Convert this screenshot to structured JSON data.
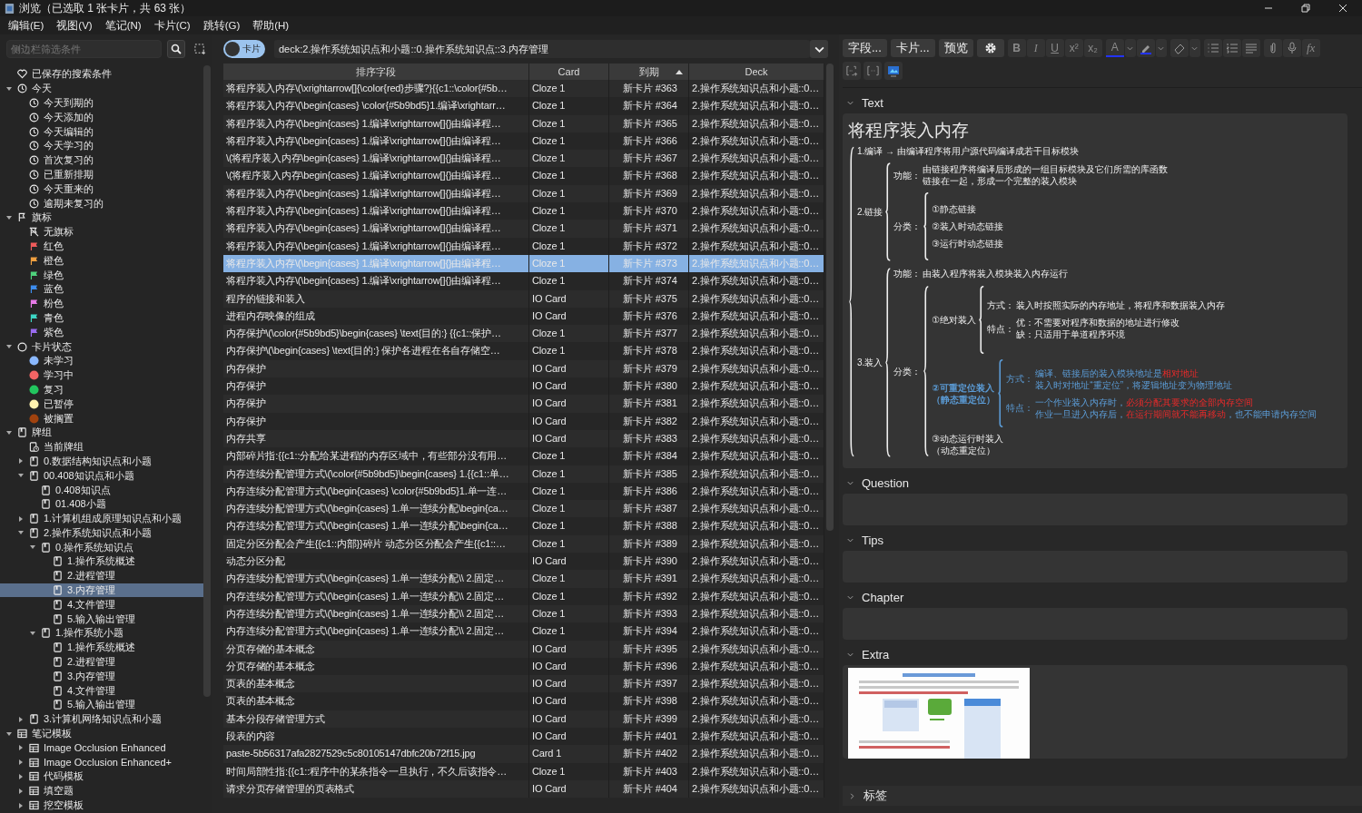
{
  "window": {
    "title": "浏览（已选取 1 张卡片，共 63 张）",
    "menu": [
      "编辑(E)",
      "视图(V)",
      "笔记(N)",
      "卡片(C)",
      "跳转(G)",
      "帮助(H)"
    ]
  },
  "sidebar": {
    "search_placeholder": "侧边栏筛选条件",
    "tree": [
      {
        "label": "已保存的搜索条件",
        "kind": "saved-search",
        "selected": false
      },
      {
        "label": "今天",
        "kind": "today",
        "selected": false,
        "expanded": true,
        "children": [
          {
            "label": "今天到期的",
            "kind": "time-filter",
            "selected": false
          },
          {
            "label": "今天添加的",
            "kind": "time-filter",
            "selected": false
          },
          {
            "label": "今天编辑的",
            "kind": "time-filter",
            "selected": false
          },
          {
            "label": "今天学习的",
            "kind": "time-filter",
            "selected": false
          },
          {
            "label": "首次复习的",
            "kind": "time-filter",
            "selected": false
          },
          {
            "label": "已重新排期",
            "kind": "time-filter",
            "selected": false
          },
          {
            "label": "今天重来的",
            "kind": "time-filter",
            "selected": false
          },
          {
            "label": "逾期未复习的",
            "kind": "time-filter",
            "selected": false
          }
        ]
      },
      {
        "label": "旗标",
        "kind": "flags",
        "selected": false,
        "expanded": true,
        "children": [
          {
            "label": "无旗标",
            "kind": "no-flag",
            "selected": false
          },
          {
            "label": "红色",
            "kind": "flag",
            "color": "#ef5b5b",
            "selected": false
          },
          {
            "label": "橙色",
            "kind": "flag",
            "color": "#f0a040",
            "selected": false
          },
          {
            "label": "绿色",
            "kind": "flag",
            "color": "#4fd27c",
            "selected": false
          },
          {
            "label": "蓝色",
            "kind": "flag",
            "color": "#3d8ef0",
            "selected": false
          },
          {
            "label": "粉色",
            "kind": "flag",
            "color": "#e87be8",
            "selected": false
          },
          {
            "label": "青色",
            "kind": "flag",
            "color": "#3dd6c4",
            "selected": false
          },
          {
            "label": "紫色",
            "kind": "flag",
            "color": "#9a6cf0",
            "selected": false
          }
        ]
      },
      {
        "label": "卡片状态",
        "kind": "card-state",
        "selected": false,
        "expanded": true,
        "children": [
          {
            "label": "未学习",
            "kind": "state",
            "color": "#8ab8ff",
            "selected": false
          },
          {
            "label": "学习中",
            "kind": "state",
            "color": "#f36565",
            "selected": false
          },
          {
            "label": "复习",
            "kind": "state",
            "color": "#22c55e",
            "selected": false
          },
          {
            "label": "已暂停",
            "kind": "state",
            "color": "#fff3b0",
            "selected": false
          },
          {
            "label": "被搁置",
            "kind": "state",
            "color": "#a0420e",
            "selected": false
          }
        ]
      },
      {
        "label": "牌组",
        "kind": "decks",
        "selected": false,
        "expanded": true,
        "children": [
          {
            "label": "当前牌组",
            "kind": "current-deck",
            "selected": false
          },
          {
            "label": "0.数据结构知识点和小题",
            "kind": "deck",
            "selected": false,
            "expanded": false
          },
          {
            "label": "00.408知识点和小题",
            "kind": "deck",
            "selected": false,
            "expanded": true,
            "children": [
              {
                "label": "0.408知识点",
                "kind": "deck",
                "selected": false
              },
              {
                "label": "01.408小题",
                "kind": "deck",
                "selected": false
              }
            ]
          },
          {
            "label": "1.计算机组成原理知识点和小题",
            "kind": "deck",
            "selected": false,
            "expanded": false
          },
          {
            "label": "2.操作系统知识点和小题",
            "kind": "deck",
            "selected": false,
            "expanded": true,
            "children": [
              {
                "label": "0.操作系统知识点",
                "kind": "deck",
                "selected": false,
                "expanded": true,
                "children": [
                  {
                    "label": "1.操作系统概述",
                    "kind": "deck",
                    "selected": false
                  },
                  {
                    "label": "2.进程管理",
                    "kind": "deck",
                    "selected": false
                  },
                  {
                    "label": "3.内存管理",
                    "kind": "deck",
                    "selected": true
                  },
                  {
                    "label": "4.文件管理",
                    "kind": "deck",
                    "selected": false
                  },
                  {
                    "label": "5.输入输出管理",
                    "kind": "deck",
                    "selected": false
                  }
                ]
              },
              {
                "label": "1.操作系统小题",
                "kind": "deck",
                "selected": false,
                "expanded": true,
                "children": [
                  {
                    "label": "1.操作系统概述",
                    "kind": "deck",
                    "selected": false
                  },
                  {
                    "label": "2.进程管理",
                    "kind": "deck",
                    "selected": false
                  },
                  {
                    "label": "3.内存管理",
                    "kind": "deck",
                    "selected": false
                  },
                  {
                    "label": "4.文件管理",
                    "kind": "deck",
                    "selected": false
                  },
                  {
                    "label": "5.输入输出管理",
                    "kind": "deck",
                    "selected": false
                  }
                ]
              }
            ]
          },
          {
            "label": "3.计算机网络知识点和小题",
            "kind": "deck",
            "selected": false,
            "expanded": false
          }
        ]
      },
      {
        "label": "笔记模板",
        "kind": "note-types",
        "selected": false,
        "expanded": true,
        "children": [
          {
            "label": "Image Occlusion Enhanced",
            "kind": "note-type",
            "selected": false,
            "expanded": false
          },
          {
            "label": "Image Occlusion Enhanced+",
            "kind": "note-type",
            "selected": false,
            "expanded": false
          },
          {
            "label": "代码模板",
            "kind": "note-type",
            "selected": false,
            "expanded": false
          },
          {
            "label": "填空题",
            "kind": "note-type",
            "selected": false,
            "expanded": false
          },
          {
            "label": "挖空模板",
            "kind": "note-type",
            "selected": false,
            "expanded": false
          }
        ]
      }
    ]
  },
  "browser": {
    "mode_toggle": {
      "label": "卡片",
      "on": false
    },
    "search_value": "deck:2.操作系统知识点和小题::0.操作系统知识点::3.内存管理",
    "table": {
      "columns": [
        {
          "label": "排序字段",
          "sorted": false
        },
        {
          "label": "Card",
          "sorted": false
        },
        {
          "label": "到期",
          "sorted": true
        },
        {
          "label": "Deck",
          "sorted": false
        }
      ],
      "rows": [
        {
          "cells": [
            "将程序装入内存\\(\\xrightarrow[]{\\color{red}步骤?}{{c1::\\color{#5b…",
            "Cloze 1",
            "新卡片 #363",
            "2.操作系统知识点和小题::0…"
          ],
          "selected": false
        },
        {
          "cells": [
            "将程序装入内存\\(\\begin{cases} \\color{#5b9bd5}1.编译\\xrightarr…",
            "Cloze 1",
            "新卡片 #364",
            "2.操作系统知识点和小题::0…"
          ],
          "selected": false
        },
        {
          "cells": [
            "将程序装入内存\\(\\begin{cases} 1.编译\\xrightarrow[]{}由编译程…",
            "Cloze 1",
            "新卡片 #365",
            "2.操作系统知识点和小题::0…"
          ],
          "selected": false
        },
        {
          "cells": [
            "将程序装入内存\\(\\begin{cases} 1.编译\\xrightarrow[]{}由编译程…",
            "Cloze 1",
            "新卡片 #366",
            "2.操作系统知识点和小题::0…"
          ],
          "selected": false
        },
        {
          "cells": [
            "\\(将程序装入内存\\begin{cases} 1.编译\\xrightarrow[]{}由编译程…",
            "Cloze 1",
            "新卡片 #367",
            "2.操作系统知识点和小题::0…"
          ],
          "selected": false
        },
        {
          "cells": [
            "\\(将程序装入内存\\begin{cases} 1.编译\\xrightarrow[]{}由编译程…",
            "Cloze 1",
            "新卡片 #368",
            "2.操作系统知识点和小题::0…"
          ],
          "selected": false
        },
        {
          "cells": [
            "将程序装入内存\\(\\begin{cases} 1.编译\\xrightarrow[]{}由编译程…",
            "Cloze 1",
            "新卡片 #369",
            "2.操作系统知识点和小题::0…"
          ],
          "selected": false
        },
        {
          "cells": [
            "将程序装入内存\\(\\begin{cases} 1.编译\\xrightarrow[]{}由编译程…",
            "Cloze 1",
            "新卡片 #370",
            "2.操作系统知识点和小题::0…"
          ],
          "selected": false
        },
        {
          "cells": [
            "将程序装入内存\\(\\begin{cases} 1.编译\\xrightarrow[]{}由编译程…",
            "Cloze 1",
            "新卡片 #371",
            "2.操作系统知识点和小题::0…"
          ],
          "selected": false
        },
        {
          "cells": [
            "将程序装入内存\\(\\begin{cases} 1.编译\\xrightarrow[]{}由编译程…",
            "Cloze 1",
            "新卡片 #372",
            "2.操作系统知识点和小题::0…"
          ],
          "selected": false
        },
        {
          "cells": [
            "将程序装入内存\\(\\begin{cases} 1.编译\\xrightarrow[]{}由编译程…",
            "Cloze 1",
            "新卡片 #373",
            "2.操作系统知识点和小题::0…"
          ],
          "selected": true
        },
        {
          "cells": [
            "将程序装入内存\\(\\begin{cases} 1.编译\\xrightarrow[]{}由编译程…",
            "Cloze 1",
            "新卡片 #374",
            "2.操作系统知识点和小题::0…"
          ],
          "selected": false
        },
        {
          "cells": [
            "程序的链接和装入",
            "IO Card",
            "新卡片 #375",
            "2.操作系统知识点和小题::0…"
          ],
          "selected": false
        },
        {
          "cells": [
            "进程内存映像的组成",
            "IO Card",
            "新卡片 #376",
            "2.操作系统知识点和小题::0…"
          ],
          "selected": false
        },
        {
          "cells": [
            "内存保护\\(\\color{#5b9bd5}\\begin{cases} \\text{目的:} {{c1::保护…",
            "Cloze 1",
            "新卡片 #377",
            "2.操作系统知识点和小题::0…"
          ],
          "selected": false
        },
        {
          "cells": [
            "内存保护\\(\\begin{cases} \\text{目的:} 保护各进程在各自存储空…",
            "Cloze 1",
            "新卡片 #378",
            "2.操作系统知识点和小题::0…"
          ],
          "selected": false
        },
        {
          "cells": [
            "内存保护",
            "IO Card",
            "新卡片 #379",
            "2.操作系统知识点和小题::0…"
          ],
          "selected": false
        },
        {
          "cells": [
            "内存保护",
            "IO Card",
            "新卡片 #380",
            "2.操作系统知识点和小题::0…"
          ],
          "selected": false
        },
        {
          "cells": [
            "内存保护",
            "IO Card",
            "新卡片 #381",
            "2.操作系统知识点和小题::0…"
          ],
          "selected": false
        },
        {
          "cells": [
            "内存保护",
            "IO Card",
            "新卡片 #382",
            "2.操作系统知识点和小题::0…"
          ],
          "selected": false
        },
        {
          "cells": [
            "内存共享",
            "IO Card",
            "新卡片 #383",
            "2.操作系统知识点和小题::0…"
          ],
          "selected": false
        },
        {
          "cells": [
            "内部碎片指:{{c1::分配给某进程的内存区域中，有些部分没有用…",
            "Cloze 1",
            "新卡片 #384",
            "2.操作系统知识点和小题::0…"
          ],
          "selected": false
        },
        {
          "cells": [
            "内存连续分配管理方式\\(\\color{#5b9bd5}\\begin{cases} 1.{{c1::单…",
            "Cloze 1",
            "新卡片 #385",
            "2.操作系统知识点和小题::0…"
          ],
          "selected": false
        },
        {
          "cells": [
            "内存连续分配管理方式\\(\\begin{cases} \\color{#5b9bd5}1.单一连…",
            "Cloze 1",
            "新卡片 #386",
            "2.操作系统知识点和小题::0…"
          ],
          "selected": false
        },
        {
          "cells": [
            "内存连续分配管理方式\\(\\begin{cases} 1.单一连续分配\\begin{ca…",
            "Cloze 1",
            "新卡片 #387",
            "2.操作系统知识点和小题::0…"
          ],
          "selected": false
        },
        {
          "cells": [
            "内存连续分配管理方式\\(\\begin{cases} 1.单一连续分配\\begin{ca…",
            "Cloze 1",
            "新卡片 #388",
            "2.操作系统知识点和小题::0…"
          ],
          "selected": false
        },
        {
          "cells": [
            "固定分区分配会产生{{c1::内部}}碎片 动态分区分配会产生{{c1::…",
            "Cloze 1",
            "新卡片 #389",
            "2.操作系统知识点和小题::0…"
          ],
          "selected": false
        },
        {
          "cells": [
            "动态分区分配",
            "IO Card",
            "新卡片 #390",
            "2.操作系统知识点和小题::0…"
          ],
          "selected": false
        },
        {
          "cells": [
            "内存连续分配管理方式\\(\\begin{cases} 1.单一连续分配\\\\ 2.固定…",
            "Cloze 1",
            "新卡片 #391",
            "2.操作系统知识点和小题::0…"
          ],
          "selected": false
        },
        {
          "cells": [
            "内存连续分配管理方式\\(\\begin{cases} 1.单一连续分配\\\\ 2.固定…",
            "Cloze 1",
            "新卡片 #392",
            "2.操作系统知识点和小题::0…"
          ],
          "selected": false
        },
        {
          "cells": [
            "内存连续分配管理方式\\(\\begin{cases} 1.单一连续分配\\\\ 2.固定…",
            "Cloze 1",
            "新卡片 #393",
            "2.操作系统知识点和小题::0…"
          ],
          "selected": false
        },
        {
          "cells": [
            "内存连续分配管理方式\\(\\begin{cases} 1.单一连续分配\\\\ 2.固定…",
            "Cloze 1",
            "新卡片 #394",
            "2.操作系统知识点和小题::0…"
          ],
          "selected": false
        },
        {
          "cells": [
            "分页存储的基本概念",
            "IO Card",
            "新卡片 #395",
            "2.操作系统知识点和小题::0…"
          ],
          "selected": false
        },
        {
          "cells": [
            "分页存储的基本概念",
            "IO Card",
            "新卡片 #396",
            "2.操作系统知识点和小题::0…"
          ],
          "selected": false
        },
        {
          "cells": [
            "页表的基本概念",
            "IO Card",
            "新卡片 #397",
            "2.操作系统知识点和小题::0…"
          ],
          "selected": false
        },
        {
          "cells": [
            "页表的基本概念",
            "IO Card",
            "新卡片 #398",
            "2.操作系统知识点和小题::0…"
          ],
          "selected": false
        },
        {
          "cells": [
            "基本分段存储管理方式",
            "IO Card",
            "新卡片 #399",
            "2.操作系统知识点和小题::0…"
          ],
          "selected": false
        },
        {
          "cells": [
            "段表的内容",
            "IO Card",
            "新卡片 #401",
            "2.操作系统知识点和小题::0…"
          ],
          "selected": false
        },
        {
          "cells": [
            "paste-5b56317afa2827529c5c80105147dbfc20b72f15.jpg",
            "Card 1",
            "新卡片 #402",
            "2.操作系统知识点和小题::0…"
          ],
          "selected": false
        },
        {
          "cells": [
            "时间局部性指:{{c1::程序中的某条指令一旦执行，不久后该指令…",
            "Cloze 1",
            "新卡片 #403",
            "2.操作系统知识点和小题::0…"
          ],
          "selected": false
        },
        {
          "cells": [
            "请求分页存储管理的页表格式",
            "IO Card",
            "新卡片 #404",
            "2.操作系统知识点和小题::0…"
          ],
          "selected": false
        }
      ]
    }
  },
  "editor": {
    "toolbar": {
      "buttons": [
        "字段...",
        "卡片...",
        "预览"
      ],
      "format": [
        {
          "label": "B",
          "kind": "bold"
        },
        {
          "label": "I",
          "kind": "italic"
        },
        {
          "label": "U",
          "kind": "underline"
        },
        {
          "label": "x²",
          "kind": "plain"
        },
        {
          "label": "x₂",
          "kind": "plain"
        }
      ],
      "text_color_label": "A",
      "math_label": "fx"
    },
    "fields": [
      {
        "name": "Text",
        "expanded": true,
        "kind": "mindmap",
        "heading": "将程序装入内存",
        "map": {
          "children": [
            {
              "label": "1.编译 → 由编译程序将用户源代码编译成若干目标模块"
            },
            {
              "label": "2.链接",
              "children": [
                {
                  "label": "功能：",
                  "text": [
                    "由链接程序将编译后形成的一组目标模块及它们所需的库函数",
                    "链接在一起，形成一个完整的装入模块"
                  ]
                },
                {
                  "label": "分类：",
                  "children": [
                    {
                      "label": "①静态链接"
                    },
                    {
                      "label": "②装入时动态链接"
                    },
                    {
                      "label": "③运行时动态链接"
                    }
                  ]
                }
              ]
            },
            {
              "label": "3.装入",
              "children": [
                {
                  "label": "功能：",
                  "text": [
                    "由装入程序将装入模块装入内存运行"
                  ]
                },
                {
                  "label": "分类：",
                  "children": [
                    {
                      "label": "①绝对装入",
                      "children": [
                        {
                          "label": "方式：",
                          "text": [
                            "装入时按照实际的内存地址，将程序和数据装入内存"
                          ]
                        },
                        {
                          "label": "特点：",
                          "text": [
                            "优：不需要对程序和数据的地址进行修改",
                            "缺：只适用于单道程序环境"
                          ]
                        }
                      ]
                    },
                    {
                      "label": [
                        "②可重定位装入",
                        "（静态重定位）"
                      ],
                      "color": "#5b9bd5",
                      "children": [
                        {
                          "label": "方式：",
                          "text": [
                            [
                              {
                                "text": "编译、链接后的装入模块地址是"
                              },
                              {
                                "text": "相对地址",
                                "emphasis": true
                              }
                            ],
                            "装入时对地址“重定位”，将逻辑地址变为物理地址"
                          ]
                        },
                        {
                          "label": "特点：",
                          "text": [
                            [
                              {
                                "text": "一个作业装入内存时，"
                              },
                              {
                                "text": "必须分配其要求的全部内存空间",
                                "emphasis": true
                              }
                            ],
                            [
                              {
                                "text": "作业一旦进入内存后，"
                              },
                              {
                                "text": "在运行期间就不能再移动",
                                "emphasis": true
                              },
                              {
                                "text": "，也不能申请内存空间"
                              }
                            ]
                          ]
                        }
                      ]
                    },
                    {
                      "label": [
                        "③动态运行时装入",
                        "（动态重定位）"
                      ]
                    }
                  ]
                }
              ]
            }
          ]
        }
      },
      {
        "name": "Question",
        "expanded": true,
        "kind": "empty"
      },
      {
        "name": "Tips",
        "expanded": true,
        "kind": "empty"
      },
      {
        "name": "Chapter",
        "expanded": true,
        "kind": "empty"
      },
      {
        "name": "Extra",
        "expanded": true,
        "kind": "picture"
      }
    ],
    "tags": {
      "label": "标签",
      "expanded": false
    }
  }
}
